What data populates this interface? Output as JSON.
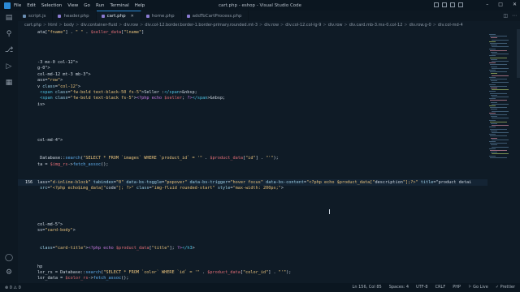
{
  "window": {
    "title": "cart.php - eshop - Visual Studio Code",
    "menu": [
      "File",
      "Edit",
      "Selection",
      "View",
      "Go",
      "Run",
      "Terminal",
      "Help"
    ]
  },
  "tabs": [
    {
      "label": "script.js",
      "active": false,
      "kind": "js"
    },
    {
      "label": "header.php",
      "active": false,
      "kind": "php"
    },
    {
      "label": "cart.php",
      "active": true,
      "kind": "php"
    },
    {
      "label": "home.php",
      "active": false,
      "kind": "php"
    },
    {
      "label": "addToCartProcess.php",
      "active": false,
      "kind": "php"
    }
  ],
  "breadcrumb": [
    "cart.php",
    "html",
    "body",
    "div.container-fluid",
    "div.row",
    "div.col-12.border.border-1.border-primary.rounded.mt-3",
    "div.row",
    "div.col-12.col-lg-9",
    "div.row",
    "div.card.mb-3.mx-0.col-12",
    "div.row.g-0",
    "div.col-md-4"
  ],
  "editor": {
    "current_line": "156",
    "lines": [
      {
        "n": "",
        "t": "ata[\"fname\"] . \" \" . $seller_data[\"lname\"]"
      },
      {
        "n": "",
        "t": ""
      },
      {
        "n": "",
        "t": ""
      },
      {
        "n": "",
        "t": ""
      },
      {
        "n": "",
        "t": ""
      },
      {
        "n": "",
        "t": "-3 mx-0 col-12\">"
      },
      {
        "n": "",
        "t": "g-0\">"
      },
      {
        "n": "",
        "t": "col-md-12 mt-3 mb-3\">"
      },
      {
        "n": "",
        "t": "ass=\"row\">"
      },
      {
        "n": "",
        "t": "v class=\"col-12\">"
      },
      {
        "n": "",
        "t": " <span class=\"fw-bold text-black-50 fs-5\">Seller :</span>&nbsp;"
      },
      {
        "n": "",
        "t": " <span class=\"fw-bold text-black fs-5\"><?php echo $seller; ?></span>&nbsp;"
      },
      {
        "n": "",
        "t": "iv>"
      },
      {
        "n": "",
        "t": ""
      },
      {
        "n": "",
        "t": ""
      },
      {
        "n": "",
        "t": ""
      },
      {
        "n": "",
        "t": ""
      },
      {
        "n": "",
        "t": ""
      },
      {
        "n": "",
        "t": "col-md-4\">"
      },
      {
        "n": "",
        "t": ""
      },
      {
        "n": "",
        "t": ""
      },
      {
        "n": "",
        "t": " Database::search(\"SELECT * FROM `images` WHERE `product_id` = '\" . $product_data[\"id\"] . \"'\");"
      },
      {
        "n": "",
        "t": "ta = $img_rs->fetch_assoc();"
      },
      {
        "n": "",
        "t": ""
      },
      {
        "n": "",
        "t": ""
      },
      {
        "n": "156",
        "t": "lass=\"d-inline-block\" tabindex=\"0\" data-bs-toggle=\"popover\" data-bs-trigger=\"hover focus\" data-bs-content=\"<?php echo $product_data[\"description\"];?>\" title=\"product detai"
      },
      {
        "n": "",
        "t": " src=\"<?php echo$img_data[\"code\"]; ?>\" class=\"img-fluid rounded-start\" style=\"max-width: 200px;\">"
      },
      {
        "n": "",
        "t": ""
      },
      {
        "n": "",
        "t": ""
      },
      {
        "n": "",
        "t": ""
      },
      {
        "n": "",
        "t": ""
      },
      {
        "n": "",
        "t": ""
      },
      {
        "n": "",
        "t": "col-md-5\">"
      },
      {
        "n": "",
        "t": "ss=\"card-body\">"
      },
      {
        "n": "",
        "t": ""
      },
      {
        "n": "",
        "t": ""
      },
      {
        "n": "",
        "t": " class=\"card-title\"><?php echo $product_data[\"title\"]; ?></h3>"
      },
      {
        "n": "",
        "t": ""
      },
      {
        "n": "",
        "t": ""
      },
      {
        "n": "",
        "t": "hp"
      },
      {
        "n": "",
        "t": "lor_rs = Database::search(\"SELECT * FROM `color` WHERE `id` = '\" . $product_data[\"color_id\"] . \"'\");"
      },
      {
        "n": "",
        "t": "lor_data = $color_rs->fetch_assoc();"
      }
    ]
  },
  "status": {
    "left": [
      "⊗ 0  ⚠ 0"
    ],
    "right": [
      "Ln 156, Col 85",
      "Spaces: 4",
      "UTF-8",
      "CRLF",
      "PHP",
      "⚐ Go Live",
      "✓ Prettier"
    ]
  }
}
